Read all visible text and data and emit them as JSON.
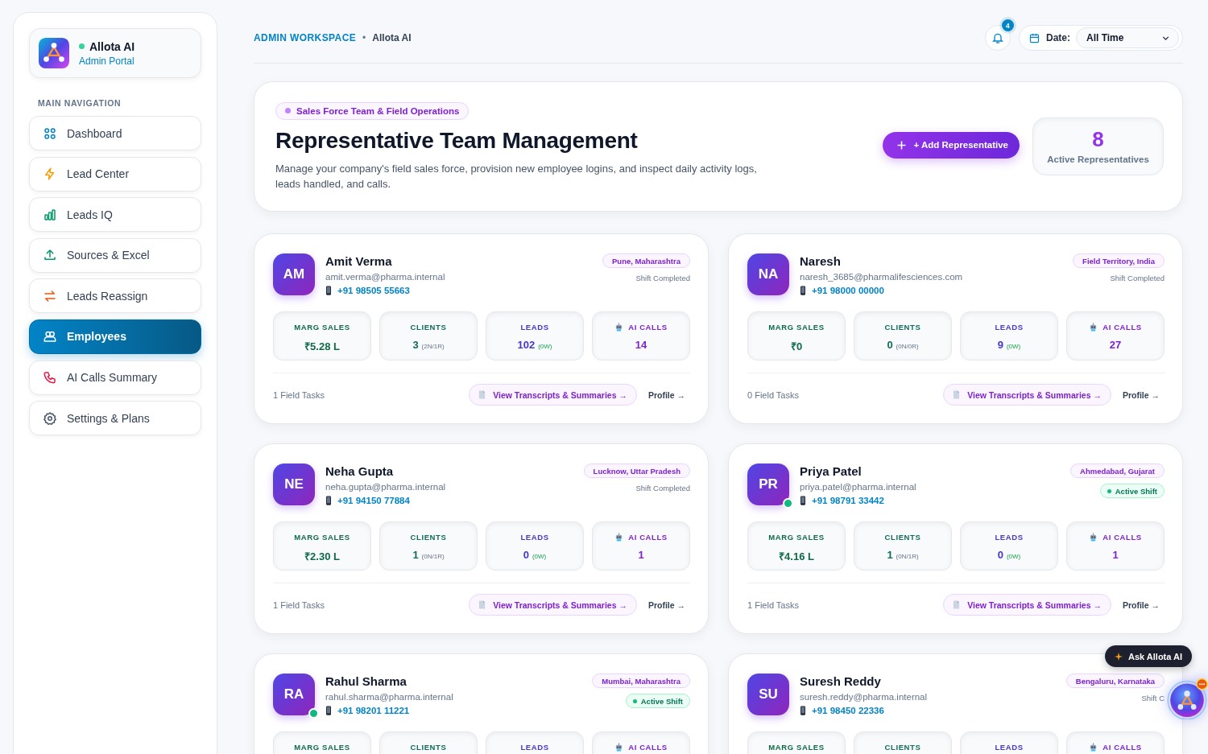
{
  "brand": {
    "name": "Allota AI",
    "subtitle": "Admin Portal",
    "online": true
  },
  "sidebar": {
    "section_label": "MAIN NAVIGATION",
    "items": [
      {
        "label": "Dashboard",
        "selected": false
      },
      {
        "label": "Lead Center",
        "selected": false
      },
      {
        "label": "Leads IQ",
        "selected": false
      },
      {
        "label": "Sources & Excel",
        "selected": false
      },
      {
        "label": "Leads Reassign",
        "selected": false
      },
      {
        "label": "Employees",
        "selected": true
      },
      {
        "label": "AI Calls Summary",
        "selected": false
      },
      {
        "label": "Settings & Plans",
        "selected": false
      }
    ]
  },
  "breadcrumb": {
    "workspace": "ADMIN WORKSPACE",
    "separator": "•",
    "current": "Allota AI"
  },
  "notifications": {
    "count": "4"
  },
  "date_filter": {
    "label": "Date:",
    "value": "All Time"
  },
  "hero": {
    "tag": "Sales Force Team & Field Operations",
    "title": "Representative Team Management",
    "description": "Manage your company's field sales force, provision new employee logins, and inspect daily activity logs, leads handled, and calls.",
    "add_button": "+ Add Representative",
    "active_count": "8",
    "active_label": "Active Representatives"
  },
  "employees": [
    {
      "initials": "AM",
      "name": "Amit Verma",
      "email": "amit.verma@pharma.internal",
      "phone": "+91 98505 55663",
      "location": "Pune, Maharashtra",
      "status": {
        "kind": "completed",
        "text": "Shift Completed"
      },
      "online": false,
      "stats": [
        {
          "kind": "sales",
          "label": "MARG SALES",
          "value": "₹5.28 L"
        },
        {
          "kind": "clients",
          "label": "CLIENTS",
          "value": "3",
          "sub": "(2N/1R)"
        },
        {
          "kind": "leads",
          "label": "LEADS",
          "value": "102",
          "sub": "(0W)"
        },
        {
          "kind": "calls",
          "label": "AI CALLS",
          "value": "14"
        }
      ],
      "tasks": "1 Field Tasks",
      "view_button": "View Transcripts & Summaries →",
      "profile_link": "Profile →"
    },
    {
      "initials": "NA",
      "name": "Naresh",
      "email": "naresh_3685@pharmalifesciences.com",
      "phone": "+91 98000 00000",
      "location": "Field Territory, India",
      "status": {
        "kind": "completed",
        "text": "Shift Completed"
      },
      "online": false,
      "stats": [
        {
          "kind": "sales",
          "label": "MARG SALES",
          "value": "₹0"
        },
        {
          "kind": "clients",
          "label": "CLIENTS",
          "value": "0",
          "sub": "(0N/0R)"
        },
        {
          "kind": "leads",
          "label": "LEADS",
          "value": "9",
          "sub": "(0W)"
        },
        {
          "kind": "calls",
          "label": "AI CALLS",
          "value": "27"
        }
      ],
      "tasks": "0 Field Tasks",
      "view_button": "View Transcripts & Summaries →",
      "profile_link": "Profile →"
    },
    {
      "initials": "NE",
      "name": "Neha Gupta",
      "email": "neha.gupta@pharma.internal",
      "phone": "+91 94150 77884",
      "location": "Lucknow, Uttar Pradesh",
      "status": {
        "kind": "completed",
        "text": "Shift Completed"
      },
      "online": false,
      "stats": [
        {
          "kind": "sales",
          "label": "MARG SALES",
          "value": "₹2.30 L"
        },
        {
          "kind": "clients",
          "label": "CLIENTS",
          "value": "1",
          "sub": "(0N/1R)"
        },
        {
          "kind": "leads",
          "label": "LEADS",
          "value": "0",
          "sub": "(0W)"
        },
        {
          "kind": "calls",
          "label": "AI CALLS",
          "value": "1"
        }
      ],
      "tasks": "1 Field Tasks",
      "view_button": "View Transcripts & Summaries →",
      "profile_link": "Profile →"
    },
    {
      "initials": "PR",
      "name": "Priya Patel",
      "email": "priya.patel@pharma.internal",
      "phone": "+91 98791 33442",
      "location": "Ahmedabad, Gujarat",
      "status": {
        "kind": "active",
        "text": "Active Shift"
      },
      "online": true,
      "stats": [
        {
          "kind": "sales",
          "label": "MARG SALES",
          "value": "₹4.16 L"
        },
        {
          "kind": "clients",
          "label": "CLIENTS",
          "value": "1",
          "sub": "(0N/1R)"
        },
        {
          "kind": "leads",
          "label": "LEADS",
          "value": "0",
          "sub": "(0W)"
        },
        {
          "kind": "calls",
          "label": "AI CALLS",
          "value": "1"
        }
      ],
      "tasks": "1 Field Tasks",
      "view_button": "View Transcripts & Summaries →",
      "profile_link": "Profile →"
    },
    {
      "initials": "RA",
      "name": "Rahul Sharma",
      "email": "rahul.sharma@pharma.internal",
      "phone": "+91 98201 11221",
      "location": "Mumbai, Maharashtra",
      "status": {
        "kind": "active",
        "text": "Active Shift"
      },
      "online": true,
      "stats": [
        {
          "kind": "sales",
          "label": "MARG SALES"
        },
        {
          "kind": "clients",
          "label": "CLIENTS"
        },
        {
          "kind": "leads",
          "label": "LEADS"
        },
        {
          "kind": "calls",
          "label": "AI CALLS"
        }
      ]
    },
    {
      "initials": "SU",
      "name": "Suresh Reddy",
      "email": "suresh.reddy@pharma.internal",
      "phone": "+91 98450 22336",
      "location": "Bengaluru, Karnataka",
      "status": {
        "kind": "completed",
        "text": "Shift C"
      },
      "online": false,
      "stats": [
        {
          "kind": "sales",
          "label": "MARG SALES"
        },
        {
          "kind": "clients",
          "label": "CLIENTS"
        },
        {
          "kind": "leads",
          "label": "LEADS"
        },
        {
          "kind": "calls",
          "label": "AI CALLS"
        }
      ]
    }
  ],
  "assistant": {
    "label": "Ask Allota AI"
  }
}
